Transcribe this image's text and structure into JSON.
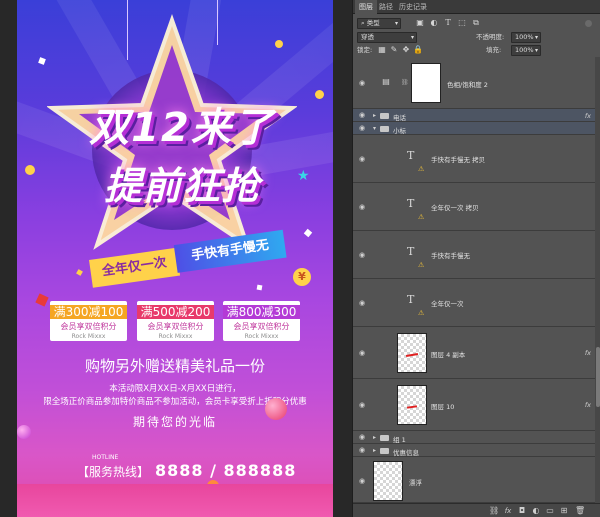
{
  "poster": {
    "title_line1": "双12来了",
    "title_line2": "提前狂抢",
    "ribbon_left": "全年仅一次",
    "ribbon_right": "手快有手慢无",
    "yen_symbol": "¥",
    "coupons": [
      {
        "amount": "满300减100",
        "sub": "会员享双倍积分",
        "brand": "Rock Mixxx",
        "color": "#f5a623"
      },
      {
        "amount": "满500减200",
        "sub": "会员享双倍积分",
        "brand": "Rock Mixxx",
        "color": "#e83a6b"
      },
      {
        "amount": "满800减300",
        "sub": "会员享双倍积分",
        "brand": "Rock Mixxx",
        "color": "#b43ad6"
      }
    ],
    "gift_line": "购物另外赠送精美礼品一份",
    "desc_line1": "本活动限X月XX日-X月XX日进行，",
    "desc_line2": "限全场正价商品参加特价商品不参加活动，会员卡享受折上折积分优惠",
    "welcome": "期待您的光临",
    "hotline_label": "HOTLINE",
    "hotline_text": "【服务热线】",
    "hotline_number": "8888 / 888888"
  },
  "panel": {
    "tabs": [
      "图层",
      "路径",
      "历史记录"
    ],
    "filter_kind": "类型",
    "blend_mode": "穿透",
    "opacity_label": "不透明度:",
    "opacity_value": "100%",
    "lock_label": "锁定:",
    "fill_label": "填充:",
    "fill_value": "100%",
    "layers": [
      {
        "name": "色相/饱和度 2",
        "kind": "adjustment"
      },
      {
        "name": "电话",
        "kind": "group-collapsed"
      },
      {
        "name": "小标",
        "kind": "group-open"
      },
      {
        "name": "手快有手慢无 拷贝",
        "kind": "text"
      },
      {
        "name": "全年仅一次 拷贝",
        "kind": "text"
      },
      {
        "name": "手快有手慢无",
        "kind": "text"
      },
      {
        "name": "全年仅一次",
        "kind": "text"
      },
      {
        "name": "图层 4 副本",
        "kind": "pixel"
      },
      {
        "name": "图层 10",
        "kind": "pixel"
      },
      {
        "name": "组 1",
        "kind": "group-collapsed"
      },
      {
        "name": "优惠信息",
        "kind": "group-collapsed"
      },
      {
        "name": "漂浮",
        "kind": "pixel"
      }
    ],
    "fx_label": "fx"
  }
}
